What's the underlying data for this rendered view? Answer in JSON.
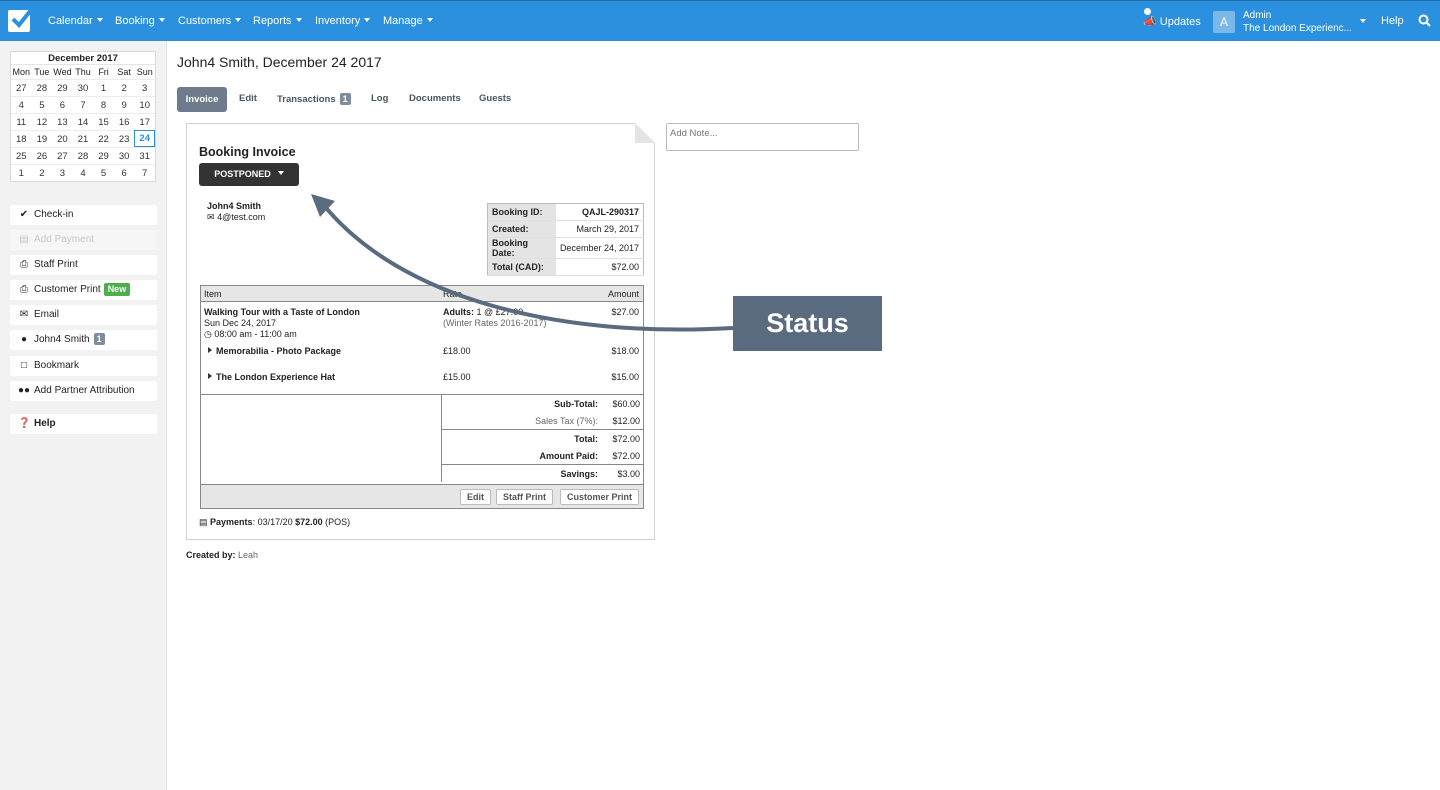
{
  "nav": {
    "items": [
      "Calendar",
      "Booking",
      "Customers",
      "Reports",
      "Inventory",
      "Manage"
    ],
    "updates": "Updates",
    "avatar_letter": "A",
    "user": "Admin",
    "org": "The London Experienc...",
    "help": "Help"
  },
  "calendar": {
    "title": "December 2017",
    "days": [
      "Mon",
      "Tue",
      "Wed",
      "Thu",
      "Fri",
      "Sat",
      "Sun"
    ],
    "weeks": [
      [
        "27",
        "28",
        "29",
        "30",
        "1",
        "2",
        "3"
      ],
      [
        "4",
        "5",
        "6",
        "7",
        "8",
        "9",
        "10"
      ],
      [
        "11",
        "12",
        "13",
        "14",
        "15",
        "16",
        "17"
      ],
      [
        "18",
        "19",
        "20",
        "21",
        "22",
        "23",
        "24"
      ],
      [
        "25",
        "26",
        "27",
        "28",
        "29",
        "30",
        "31"
      ],
      [
        "1",
        "2",
        "3",
        "4",
        "5",
        "6",
        "7"
      ]
    ],
    "selected": "24"
  },
  "sidebar": {
    "checkin": "Check-in",
    "add_payment": "Add Payment",
    "staff_print": "Staff Print",
    "customer_print": "Customer Print",
    "new_badge": "New",
    "email": "Email",
    "customer": "John4 Smith",
    "customer_count": "1",
    "bookmark": "Bookmark",
    "partner": "Add Partner Attribution",
    "help": "Help"
  },
  "page": {
    "title": "John4 Smith, December 24 2017",
    "tabs": {
      "invoice": "Invoice",
      "edit": "Edit",
      "transactions": "Transactions",
      "transactions_count": "1",
      "log": "Log",
      "documents": "Documents",
      "guests": "Guests"
    }
  },
  "invoice": {
    "title": "Booking Invoice",
    "status": "POSTPONED",
    "customer_name": "John4 Smith",
    "customer_email": "4@test.com",
    "info": {
      "booking_id_label": "Booking ID:",
      "booking_id": "QAJL-290317",
      "created_label": "Created:",
      "created": "March 29, 2017",
      "booking_date_label": "Booking Date:",
      "booking_date": "December 24, 2017",
      "total_label": "Total (CAD):",
      "total": "$72.00"
    },
    "headers": {
      "item": "Item",
      "rate": "Rate",
      "amount": "Amount"
    },
    "main_item": {
      "name": "Walking Tour with a Taste of London",
      "date": "Sun Dec 24, 2017",
      "time": "08:00 am - 11:00 am",
      "rate_label": "Adults:",
      "rate": "1 @ £27.00",
      "rate_note": "(Winter Rates 2016-2017)",
      "amount": "$27.00"
    },
    "addons": [
      {
        "name": "Memorabilia - Photo Package",
        "rate": "£18.00",
        "amount": "$18.00"
      },
      {
        "name": "The London Experience Hat",
        "rate": "£15.00",
        "amount": "$15.00"
      }
    ],
    "totals": {
      "subtotal_label": "Sub-Total:",
      "subtotal": "$60.00",
      "tax_label": "Sales Tax (7%):",
      "tax": "$12.00",
      "total_label": "Total:",
      "total": "$72.00",
      "paid_label": "Amount Paid:",
      "paid": "$72.00",
      "savings_label": "Savings:",
      "savings": "$3.00"
    },
    "buttons": {
      "edit": "Edit",
      "staff_print": "Staff Print",
      "customer_print": "Customer Print"
    },
    "payments_label": "Payments",
    "payments_date": ": 03/17/20",
    "payments_amount": "$72.00",
    "payments_method": "(POS)"
  },
  "created_by_label": "Created by:",
  "created_by": "Leah",
  "note_placeholder": "Add Note...",
  "annotation": "Status",
  "colors": {
    "nav": "#2b91df",
    "annotation": "#5a6b80",
    "tab_active": "#6d7b8c",
    "new_badge": "#4cae4c"
  }
}
